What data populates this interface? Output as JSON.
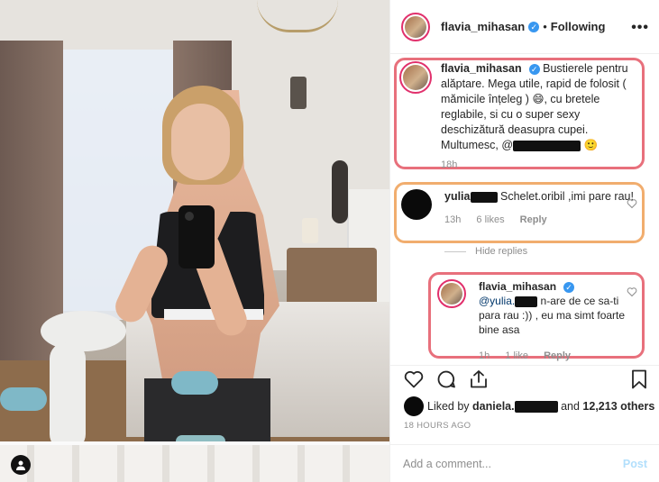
{
  "header": {
    "username": "flavia_mihasan",
    "separator": "•",
    "follow_status": "Following",
    "more_label": "•••"
  },
  "comments": {
    "caption": {
      "username": "flavia_mihasan",
      "text": "Bustierele pentru alăptare. Mega utile, rapid de folosit ( mămicile înțeleg )",
      "emoji1": "😄",
      "text2": ", cu bretele reglabile, si cu o super sexy deschizătură deasupra cupei. Multumesc, @",
      "emoji2": "🙂",
      "time": "18h"
    },
    "comment1": {
      "username": "yulia",
      "text": "Schelet.oribil ,imi pare rau!",
      "time": "13h",
      "likes": "6 likes",
      "reply": "Reply"
    },
    "hide_replies": "Hide replies",
    "reply1": {
      "username": "flavia_mihasan",
      "mention": "@yulia.",
      "text": "n-are de ce sa-ti para rau :)) , eu ma simt foarte bine asa",
      "time": "1h",
      "likes": "1 like",
      "reply": "Reply"
    }
  },
  "likes": {
    "prefix": "Liked by",
    "user": "daniela.",
    "and": "and",
    "others": "12,213 others"
  },
  "timestamp": "18 HOURS AGO",
  "add_comment": {
    "placeholder": "Add a comment...",
    "post_label": "Post"
  },
  "colors": {
    "highlight_red": "#e8707c",
    "highlight_orange": "#f1ad6e",
    "verified_blue": "#3897f0",
    "post_disabled": "#b2dffc"
  },
  "icons": [
    "heart-icon",
    "comment-icon",
    "share-icon",
    "bookmark-icon",
    "verified-badge-icon",
    "user-icon",
    "more-options-icon"
  ]
}
